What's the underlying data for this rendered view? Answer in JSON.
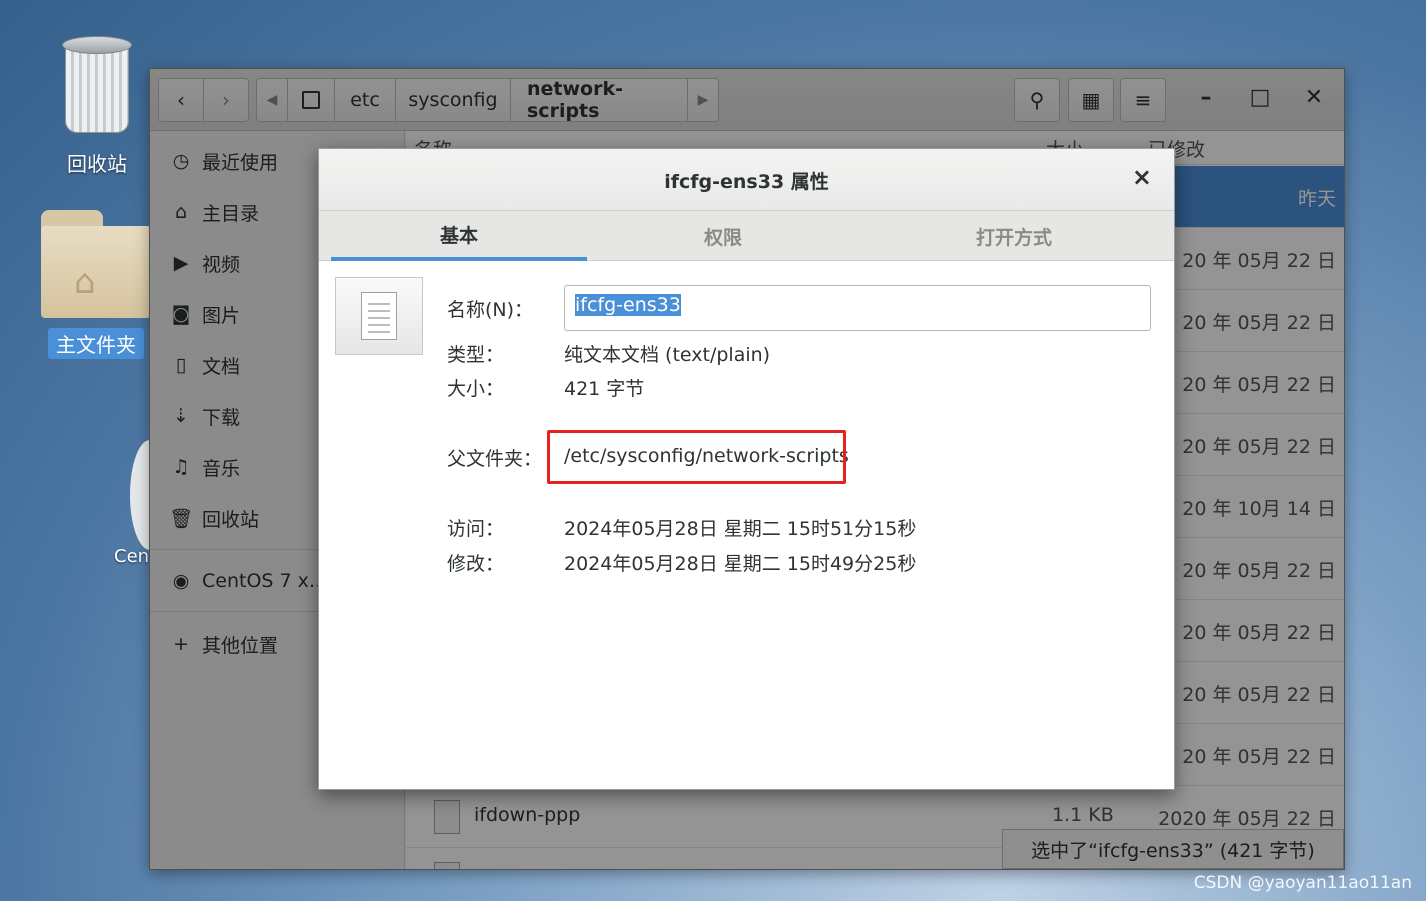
{
  "desktop": {
    "trash_label": "回收站",
    "home_label": "主文件夹",
    "cent_label": "Cen"
  },
  "window": {
    "breadcrumbs": [
      "etc",
      "sysconfig",
      "network-scripts"
    ],
    "sidebar": [
      {
        "icon": "clock-icon",
        "label": "最近使用"
      },
      {
        "icon": "home-icon",
        "label": "主目录"
      },
      {
        "icon": "video-icon",
        "label": "视频"
      },
      {
        "icon": "camera-icon",
        "label": "图片"
      },
      {
        "icon": "document-icon",
        "label": "文档"
      },
      {
        "icon": "download-icon",
        "label": "下载"
      },
      {
        "icon": "music-icon",
        "label": "音乐"
      },
      {
        "icon": "trash-icon",
        "label": "回收站"
      },
      {
        "icon": "disc-icon",
        "label": "CentOS 7 x…"
      },
      {
        "icon": "plus-icon",
        "label": "其他位置"
      }
    ],
    "columns": {
      "name": "名称",
      "size": "大小",
      "modified": "已修改"
    },
    "rows": [
      {
        "date": "昨天"
      },
      {
        "date": "20 年 05月 22 日"
      },
      {
        "date": "20 年 05月 22 日"
      },
      {
        "date": "20 年 05月 22 日"
      },
      {
        "date": "20 年 05月 22 日"
      },
      {
        "date": "20 年 10月 14 日"
      },
      {
        "date": "20 年 05月 22 日"
      },
      {
        "date": "20 年 05月 22 日"
      },
      {
        "date": "20 年 05月 22 日"
      },
      {
        "date": "20 年 05月 22 日"
      }
    ],
    "visible_file": {
      "name": "ifdown-ppp",
      "size": "1.1 KB",
      "date": "2020 年 05月 22 日"
    },
    "status": "选中了“ifcfg-ens33” (421 字节)"
  },
  "dialog": {
    "title": "ifcfg-ens33 属性",
    "tabs": [
      "基本",
      "权限",
      "打开方式"
    ],
    "name_label": "名称(N)：",
    "name_value": "ifcfg-ens33",
    "type_label": "类型：",
    "type_value": "纯文本文档 (text/plain)",
    "size_label": "大小：",
    "size_value": "421 字节",
    "parent_label": "父文件夹：",
    "parent_value": "/etc/sysconfig/network-scripts",
    "accessed_label": "访问：",
    "accessed_value": "2024年05月28日 星期二 15时51分15秒",
    "modified_label": "修改：",
    "modified_value": "2024年05月28日 星期二 15时49分25秒"
  },
  "watermark": "CSDN @yaoyan11ao11an",
  "colors": {
    "accent": "#4a90d9",
    "highlight_box": "#e52222"
  }
}
